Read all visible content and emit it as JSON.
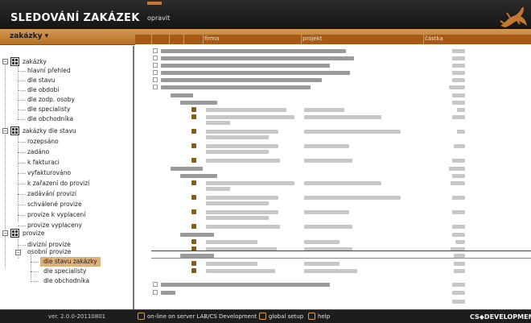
{
  "header": {
    "title": "SLEDOVÁNÍ ZAKÁZEK",
    "edit_tab": "opravit"
  },
  "menubar": {
    "main_menu": "zakázky",
    "arrow": "▾"
  },
  "sidebar": {
    "groups": [
      {
        "label": "zakázky",
        "expanded": true,
        "items": [
          "hlavní přehled",
          "dle stavu",
          "dle období",
          "dle zodp. osoby",
          "dle specialisty",
          "dle obchodníka"
        ]
      },
      {
        "label": "zakázky dle stavu",
        "expanded": true,
        "items": [
          "rozepsáno",
          "zadáno",
          "k fakturaci",
          "vyfakturováno",
          "k zařazení do provizí",
          "zadávání provizí",
          "schválené provize",
          "provize k vyplacení",
          "provize vyplaceny"
        ]
      },
      {
        "label": "provize",
        "expanded": true,
        "items": [
          "divizní provize",
          "osobní provize"
        ],
        "subitems": [
          "dle stavu zakázky",
          "dle specialisty",
          "dle obchodníka"
        ],
        "selected_subitem": "dle stavu zakázky"
      }
    ]
  },
  "table": {
    "columns": [
      "firma",
      "projekt",
      "částka"
    ]
  },
  "statusbar": {
    "version": "ver. 2.0.0-20110801",
    "online": "on-line on server LAB/CS Development",
    "global_setup": "global setup",
    "help": "help",
    "brand": "CS◆DEVELOPMENT"
  },
  "colors": {
    "accent": "#c07830",
    "column_header": "#a65a16",
    "selected_item": "#ddb07a",
    "topbar": "#222222"
  }
}
